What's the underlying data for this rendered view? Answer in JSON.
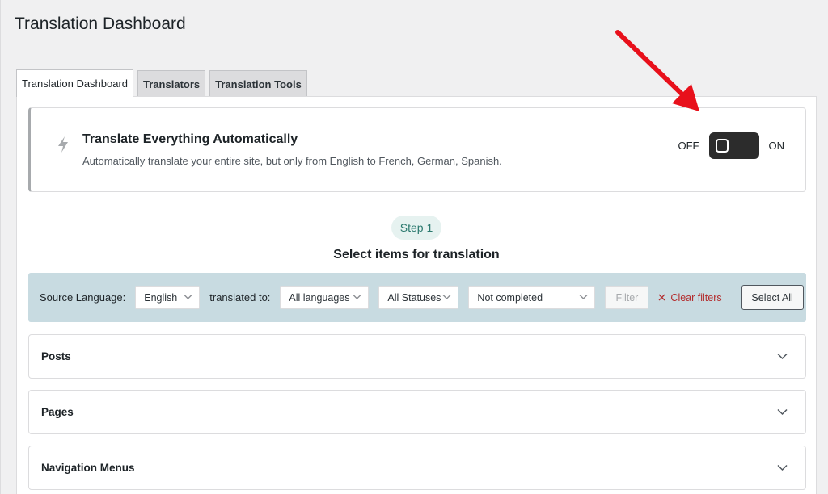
{
  "page": {
    "title": "Translation Dashboard"
  },
  "tabs": [
    {
      "label": "Translation Dashboard",
      "active": true
    },
    {
      "label": "Translators",
      "active": false
    },
    {
      "label": "Translation Tools",
      "active": false
    }
  ],
  "auto_translate": {
    "icon": "bolt-icon",
    "title": "Translate Everything Automatically",
    "description": "Automatically translate your entire site, but only from English to French, German, Spanish.",
    "toggle": {
      "off_label": "OFF",
      "on_label": "ON",
      "state": "off"
    }
  },
  "annotation": {
    "arrow_color": "#e8101b"
  },
  "step": {
    "badge": "Step 1",
    "heading": "Select items for translation"
  },
  "filters": {
    "source_label": "Source Language:",
    "source_value": "English",
    "translated_to_label": "translated to:",
    "languages_value": "All languages",
    "status_value": "All Statuses",
    "completion_value": "Not completed",
    "filter_button": "Filter",
    "clear_filters": "Clear filters",
    "select_all": "Select All"
  },
  "sections": [
    {
      "label": "Posts"
    },
    {
      "label": "Pages"
    },
    {
      "label": "Navigation Menus"
    }
  ],
  "colors": {
    "background": "#f0f0f1",
    "filter_bar": "#c8dbe1",
    "step_badge_bg": "#e6f2f0",
    "step_badge_text": "#2c7a6f",
    "clear_filters": "#b32d2e",
    "toggle_bg": "#2c2c2c"
  }
}
